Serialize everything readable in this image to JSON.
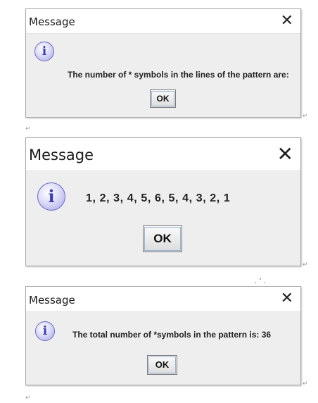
{
  "dialogs": [
    {
      "title": "Message",
      "close_glyph": "✕",
      "icon": "info-icon",
      "icon_glyph": "i",
      "message": "The number of * symbols in the lines of the pattern are:",
      "ok_label": "OK"
    },
    {
      "title": "Message",
      "close_glyph": "✕",
      "icon": "info-icon",
      "icon_glyph": "i",
      "message": "1,  2,  3,  4,  5,  6,  5,  4,  3,  2,  1",
      "ok_label": "OK"
    },
    {
      "title": "Message",
      "close_glyph": "✕",
      "icon": "info-icon",
      "icon_glyph": "i",
      "message": "The total number of *symbols in the pattern is: 36",
      "ok_label": "OK"
    }
  ],
  "paragraph_marks": [
    "↵",
    "↵",
    "↵",
    "↵",
    "↵"
  ],
  "colors": {
    "dialog_bg": "#eeeeee",
    "titlebar_bg": "#ffffff",
    "icon_fill": "#c8c8f0",
    "icon_border": "#6b6bc4"
  }
}
